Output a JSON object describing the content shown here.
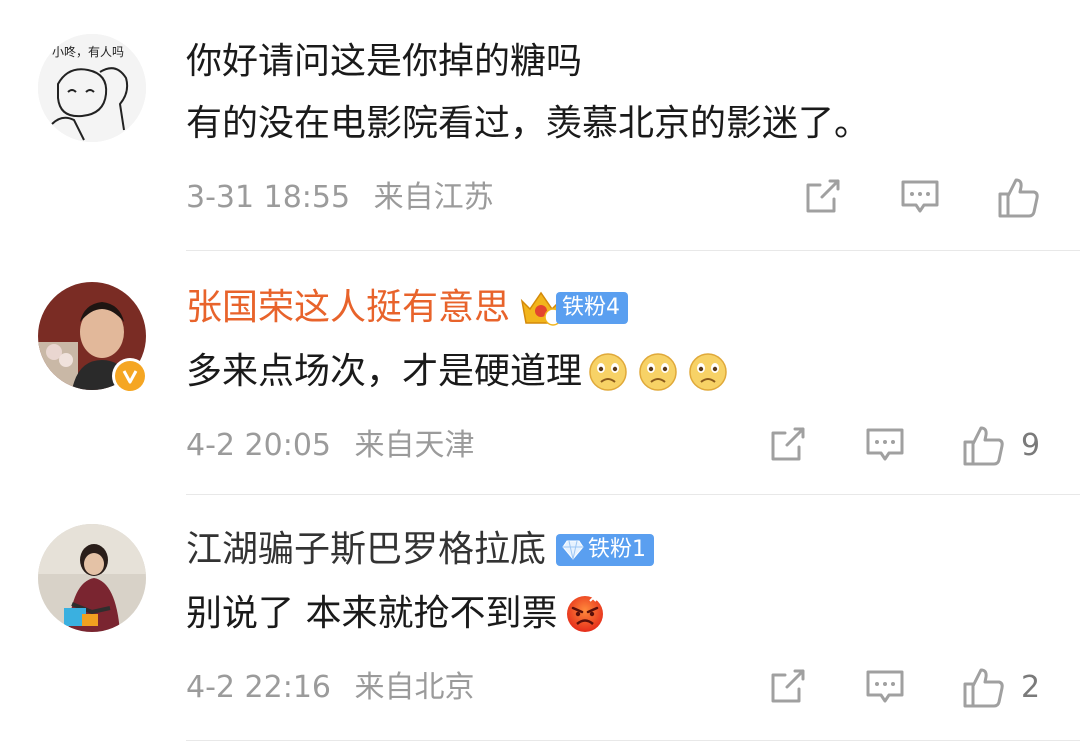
{
  "comments": [
    {
      "username": "",
      "username_style": "plain",
      "avatar_text": "小咚，有人吗",
      "text": "你好请问这是你掉的糖吗",
      "text2": "有的没在电影院看过，羡慕北京的影迷了。",
      "time": "3-31 18:55",
      "location": "来自江苏",
      "likes": ""
    },
    {
      "username": "张国荣这人挺有意思",
      "username_style": "vip",
      "badge": "铁粉4",
      "verified": true,
      "text": "多来点场次，才是硬道理",
      "emoji": [
        "sad-face-emoji",
        "sad-face-emoji",
        "sad-face-emoji"
      ],
      "time": "4-2 20:05",
      "location": "来自天津",
      "likes": "9"
    },
    {
      "username": "江湖骗子斯巴罗格拉底",
      "username_style": "plain",
      "badge": "铁粉1",
      "text": "别说了 本来就抢不到票",
      "emoji": [
        "angry-face-emoji"
      ],
      "time": "4-2 22:16",
      "location": "来自北京",
      "likes": "2"
    }
  ],
  "colors": {
    "vip_name": "#e8632b",
    "badge_blue": "#5a9ff0",
    "meta_gray": "#9b9b9b",
    "verified_gold": "#f5a623"
  }
}
